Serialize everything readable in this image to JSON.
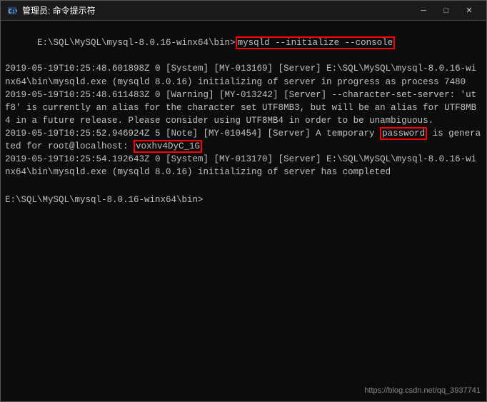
{
  "titlebar": {
    "title": "管理员: 命令提示符",
    "minimize_label": "─",
    "maximize_label": "□",
    "close_label": "✕"
  },
  "terminal": {
    "prompt": "E:\\SQL\\MySQL\\mysql-8.0.16-winx64\\bin>",
    "command": "mysqld --initialize --console",
    "lines": [
      {
        "text": "E:\\SQL\\MySQL\\mysql-8.0.16-winx64\\bin>",
        "type": "prompt_with_cmd"
      },
      {
        "text": "2019-05-19T10:25:48.601898Z 0 [System] [MY-013169] [Server] E:\\SQL\\MySQL\\mysql-8.0.16-wi\nnx64\\bin\\mysqld.exe (mysqld 8.0.16) initializing of server in progress as process 7480",
        "type": "normal"
      },
      {
        "text": "2019-05-19T10:25:48.611483Z 0 [Warning] [MY-013242] [Server] --character-set-server: 'ut\nf8' is currently an alias for the character set UTF8MB3, but will be an alias for UTF8MB\n4 in a future release. Please consider using UTF8MB4 in order to be unambiguous.",
        "type": "normal"
      },
      {
        "text_before": "2019-05-19T10:25:52.946924Z 5 [Note] [MY-010454] [Server] A temporary ",
        "text_highlighted": "password",
        "text_after": " is genera\nted for root@localhost: ",
        "text_password": "voxhv4DyC_1G",
        "type": "with_highlights"
      },
      {
        "text": "2019-05-19T10:25:54.192643Z 0 [System] [MY-013170] [Server] E:\\SQL\\MySQL\\mysql-8.0.16-wi\nnx64\\bin\\mysqld.exe (mysqld 8.0.16) initializing of server has completed",
        "type": "normal"
      }
    ],
    "final_prompt": "E:\\SQL\\MySQL\\mysql-8.0.16-winx64\\bin>",
    "watermark": "https://blog.csdn.net/qq_3937741"
  }
}
